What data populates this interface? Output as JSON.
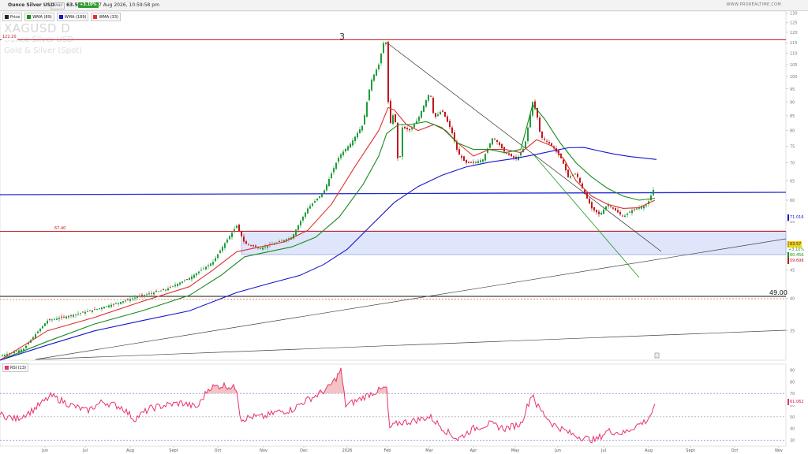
{
  "header": {
    "title": "Ounce Silver USD",
    "period": "DAILY",
    "price": "63.57",
    "change": "+3.10%",
    "datetime": "7 Aug 2026, 10:59:58 pm",
    "brand": "WWW.PRORÉALTIME.COM"
  },
  "legend": [
    {
      "label": "Price",
      "color": "#222222"
    },
    {
      "label": "WMA (89)",
      "color": "#1a8a1a"
    },
    {
      "label": "WMA (189)",
      "color": "#1515d0"
    },
    {
      "label": "WMA (33)",
      "color": "#e03030"
    }
  ],
  "watermark": {
    "symbol": "XAGUSD  D",
    "name": "Ounce Silver USD",
    "desc": "Gold & Silver (Spot)"
  },
  "annotations": {
    "wave": "3",
    "level_top": "122.20",
    "level_mid": "67.40",
    "level_low": "49.00"
  },
  "price_tags": {
    "wma189": "71.016",
    "price": "63.57",
    "price_chg": "+3.10%",
    "wma89": "60.456",
    "wma33": "59.698"
  },
  "rsi": {
    "label": "RSI (13)",
    "value": "61.062",
    "color": "#e8336b"
  },
  "colors": {
    "up": "#1f9d3a",
    "down": "#c0181c",
    "wma33": "#e03030",
    "wma89": "#1a8a1a",
    "wma189": "#1515d0",
    "zone": "#dfe6fb",
    "rsi": "#e8336b"
  },
  "chart_data": {
    "type": "line",
    "x_axis": {
      "labels": [
        "Jun",
        "Jul",
        "Aug",
        "Sept",
        "Oct",
        "Nov",
        "Dec",
        "2026",
        "Feb",
        "Mar",
        "Apr",
        "May",
        "Jun",
        "Jul",
        "Aug",
        "Sept",
        "Oct",
        "Nov"
      ]
    },
    "y_axis": {
      "scale": "log",
      "ticks": [
        35,
        40,
        45,
        50,
        55,
        60,
        65,
        70,
        75,
        80,
        85,
        90,
        95,
        100,
        105,
        110,
        115,
        120,
        125,
        130
      ],
      "range": [
        31,
        131
      ]
    },
    "rsi_axis": {
      "ticks": [
        30,
        40,
        50,
        60,
        70,
        80,
        90
      ],
      "range": [
        25,
        95
      ],
      "levels": [
        30,
        50,
        70
      ]
    },
    "series": [
      {
        "name": "Price",
        "anchors": [
          [
            0,
            31.5
          ],
          [
            30,
            32.5
          ],
          [
            60,
            36.5
          ],
          [
            90,
            37.3
          ],
          [
            120,
            38.2
          ],
          [
            150,
            39.3
          ],
          [
            180,
            40.5
          ],
          [
            210,
            41.5
          ],
          [
            240,
            43.5
          ],
          [
            270,
            46.5
          ],
          [
            300,
            54
          ],
          [
            310,
            50.2
          ],
          [
            330,
            49.2
          ],
          [
            350,
            50.3
          ],
          [
            370,
            51.5
          ],
          [
            390,
            58
          ],
          [
            410,
            62
          ],
          [
            430,
            72
          ],
          [
            445,
            76
          ],
          [
            460,
            82
          ],
          [
            470,
            98
          ],
          [
            480,
            105
          ],
          [
            488,
            118
          ],
          [
            490,
            112
          ],
          [
            493,
            79
          ],
          [
            497,
            86
          ],
          [
            502,
            82
          ],
          [
            505,
            66
          ],
          [
            510,
            81
          ],
          [
            520,
            80
          ],
          [
            530,
            84
          ],
          [
            545,
            94
          ],
          [
            550,
            84
          ],
          [
            560,
            87
          ],
          [
            572,
            80
          ],
          [
            580,
            73
          ],
          [
            590,
            70
          ],
          [
            600,
            70
          ],
          [
            612,
            71
          ],
          [
            625,
            78
          ],
          [
            640,
            73
          ],
          [
            655,
            71
          ],
          [
            665,
            75
          ],
          [
            675,
            90
          ],
          [
            680,
            86
          ],
          [
            685,
            78
          ],
          [
            700,
            75
          ],
          [
            712,
            71
          ],
          [
            720,
            66
          ],
          [
            730,
            67
          ],
          [
            740,
            62
          ],
          [
            750,
            58
          ],
          [
            760,
            56.5
          ],
          [
            770,
            59
          ],
          [
            780,
            57.5
          ],
          [
            790,
            56
          ],
          [
            800,
            57.5
          ],
          [
            810,
            58.2
          ],
          [
            820,
            58.8
          ],
          [
            830,
            63.57
          ]
        ]
      },
      {
        "name": "WMA (33)",
        "anchors": [
          [
            0,
            31
          ],
          [
            60,
            35
          ],
          [
            120,
            37
          ],
          [
            180,
            39.5
          ],
          [
            240,
            42
          ],
          [
            270,
            45
          ],
          [
            300,
            48.5
          ],
          [
            330,
            49.5
          ],
          [
            360,
            50.5
          ],
          [
            390,
            53
          ],
          [
            420,
            59
          ],
          [
            450,
            69
          ],
          [
            480,
            80
          ],
          [
            492,
            88
          ],
          [
            500,
            87
          ],
          [
            515,
            82
          ],
          [
            530,
            80
          ],
          [
            550,
            82
          ],
          [
            565,
            80
          ],
          [
            580,
            76
          ],
          [
            600,
            72
          ],
          [
            620,
            74
          ],
          [
            640,
            74
          ],
          [
            660,
            73
          ],
          [
            680,
            77
          ],
          [
            700,
            75
          ],
          [
            715,
            71
          ],
          [
            730,
            65
          ],
          [
            750,
            61
          ],
          [
            770,
            59
          ],
          [
            790,
            58
          ],
          [
            810,
            58.2
          ],
          [
            830,
            60
          ]
        ]
      },
      {
        "name": "WMA (89)",
        "anchors": [
          [
            0,
            31
          ],
          [
            60,
            33.5
          ],
          [
            120,
            36
          ],
          [
            180,
            38
          ],
          [
            240,
            40.5
          ],
          [
            280,
            44
          ],
          [
            310,
            47.5
          ],
          [
            340,
            48.5
          ],
          [
            370,
            49.5
          ],
          [
            400,
            51.5
          ],
          [
            430,
            56
          ],
          [
            460,
            64
          ],
          [
            480,
            72
          ],
          [
            490,
            79
          ],
          [
            505,
            82
          ],
          [
            520,
            82
          ],
          [
            540,
            83
          ],
          [
            560,
            81
          ],
          [
            580,
            76
          ],
          [
            600,
            74
          ],
          [
            620,
            74
          ],
          [
            640,
            73
          ],
          [
            660,
            74
          ],
          [
            675,
            89
          ],
          [
            690,
            84
          ],
          [
            710,
            76
          ],
          [
            730,
            70
          ],
          [
            750,
            66
          ],
          [
            770,
            63
          ],
          [
            790,
            61
          ],
          [
            810,
            60
          ],
          [
            830,
            60.5
          ]
        ]
      },
      {
        "name": "WMA (189)",
        "anchors": [
          [
            0,
            31
          ],
          [
            60,
            33
          ],
          [
            120,
            35
          ],
          [
            180,
            36.5
          ],
          [
            240,
            38
          ],
          [
            300,
            41
          ],
          [
            340,
            42.5
          ],
          [
            380,
            44
          ],
          [
            410,
            46
          ],
          [
            440,
            49
          ],
          [
            470,
            54
          ],
          [
            500,
            59.5
          ],
          [
            530,
            63.5
          ],
          [
            560,
            66.5
          ],
          [
            590,
            68.8
          ],
          [
            620,
            70.2
          ],
          [
            650,
            71.2
          ],
          [
            680,
            72.5
          ],
          [
            700,
            73.5
          ],
          [
            720,
            74.5
          ],
          [
            740,
            74.6
          ],
          [
            760,
            73.5
          ],
          [
            780,
            72.5
          ],
          [
            800,
            71.8
          ],
          [
            832,
            71
          ]
        ]
      },
      {
        "name": "RSI (13)",
        "anchors": [
          [
            0,
            52
          ],
          [
            20,
            48
          ],
          [
            40,
            55
          ],
          [
            65,
            68
          ],
          [
            90,
            60
          ],
          [
            110,
            55
          ],
          [
            130,
            63
          ],
          [
            155,
            58
          ],
          [
            170,
            48
          ],
          [
            190,
            57
          ],
          [
            210,
            60
          ],
          [
            230,
            62
          ],
          [
            250,
            58
          ],
          [
            265,
            75
          ],
          [
            285,
            77
          ],
          [
            300,
            74
          ],
          [
            305,
            48
          ],
          [
            320,
            50
          ],
          [
            335,
            50
          ],
          [
            350,
            54
          ],
          [
            370,
            56
          ],
          [
            385,
            63
          ],
          [
            400,
            68
          ],
          [
            415,
            74
          ],
          [
            425,
            82
          ],
          [
            432,
            90
          ],
          [
            438,
            60
          ],
          [
            450,
            63
          ],
          [
            470,
            70
          ],
          [
            490,
            75
          ],
          [
            493,
            40
          ],
          [
            505,
            45
          ],
          [
            520,
            46
          ],
          [
            545,
            50
          ],
          [
            565,
            38
          ],
          [
            580,
            31
          ],
          [
            600,
            40
          ],
          [
            620,
            44
          ],
          [
            640,
            40
          ],
          [
            660,
            44
          ],
          [
            675,
            71
          ],
          [
            680,
            60
          ],
          [
            700,
            44
          ],
          [
            725,
            35
          ],
          [
            740,
            32
          ],
          [
            755,
            30
          ],
          [
            770,
            38
          ],
          [
            790,
            36
          ],
          [
            805,
            42
          ],
          [
            820,
            47
          ],
          [
            830,
            58
          ]
        ]
      }
    ]
  }
}
